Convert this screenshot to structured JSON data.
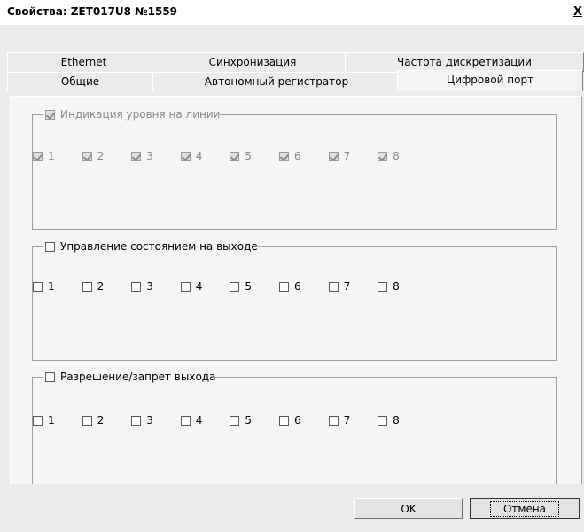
{
  "window": {
    "title": "Свойства: ZET017U8 №1559",
    "close_label": "X"
  },
  "tabs_row1": [
    {
      "label": "Ethernet"
    },
    {
      "label": "Синхронизация"
    },
    {
      "label": "Частота дискретизации"
    }
  ],
  "tabs_row2": [
    {
      "label": "Общие"
    },
    {
      "label": "Автономный регистратор"
    },
    {
      "label": "Цифровой порт",
      "active": true
    }
  ],
  "groups": [
    {
      "title": "Индикация уровня на линии",
      "checked": true,
      "disabled": true,
      "items": [
        "1",
        "2",
        "3",
        "4",
        "5",
        "6",
        "7",
        "8"
      ]
    },
    {
      "title": "Управление состоянием на выходе",
      "checked": false,
      "disabled": false,
      "items": [
        "1",
        "2",
        "3",
        "4",
        "5",
        "6",
        "7",
        "8"
      ]
    },
    {
      "title": "Разрешение/запрет выхода",
      "checked": false,
      "disabled": false,
      "items": [
        "1",
        "2",
        "3",
        "4",
        "5",
        "6",
        "7",
        "8"
      ]
    }
  ],
  "buttons": {
    "ok": "OK",
    "cancel": "Отмена"
  }
}
